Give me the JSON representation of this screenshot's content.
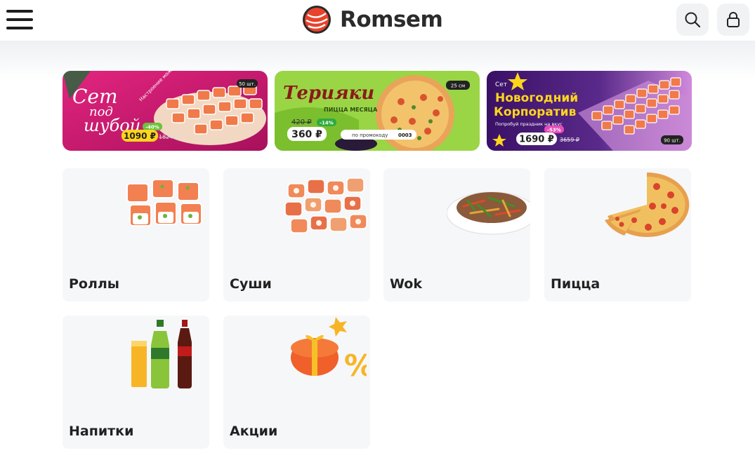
{
  "header": {
    "brand": "Romsem",
    "menu_icon": "hamburger-menu-icon",
    "search_icon": "search-icon",
    "login_icon": "lock-icon",
    "brand_color": "#e8432b"
  },
  "banners": [
    {
      "title_line1": "Сет",
      "title_line2": "под",
      "title_line3": "шубой",
      "tagline": "Настроение можно заказать!",
      "badge": "50 шт.",
      "discount": "-40%",
      "price": "1090 ₽",
      "old_price": "1824 ₽",
      "bg_color": "#c4186e"
    },
    {
      "title": "Терияки",
      "subtitle": "ПИЦЦА МЕСЯЦА",
      "badge": "25 см",
      "old_price": "420 ₽",
      "discount": "-14%",
      "price": "360 ₽",
      "promo_text": "по промокоду",
      "promo_code": "0003",
      "bg_color": "#8fcf3c"
    },
    {
      "title_small": "Сет",
      "title_line1": "Новогодний",
      "title_line2": "Корпоратив",
      "tagline": "Попробуй праздник на вкус",
      "discount": "-53%",
      "price": "1690 ₽",
      "old_price": "3659 ₽",
      "badge": "90 шт.",
      "bg_color": "#4a1a7a"
    }
  ],
  "categories": [
    {
      "label": "Роллы"
    },
    {
      "label": "Суши"
    },
    {
      "label": "Wok"
    },
    {
      "label": "Пицца"
    },
    {
      "label": "Напитки"
    },
    {
      "label": "Акции"
    }
  ]
}
